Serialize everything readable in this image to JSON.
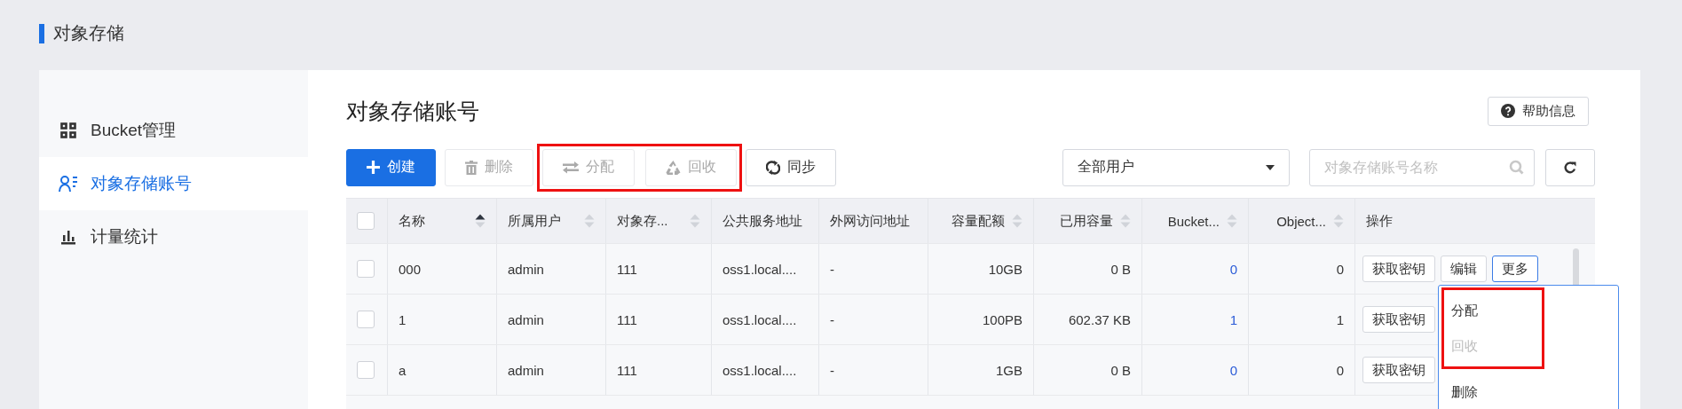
{
  "page_title": "对象存储",
  "sidebar": {
    "items": [
      {
        "label": "Bucket管理",
        "kind": "grid",
        "selected": false
      },
      {
        "label": "对象存储账号",
        "kind": "users",
        "selected": true
      },
      {
        "label": "计量统计",
        "kind": "chart",
        "selected": false
      }
    ]
  },
  "content": {
    "title": "对象存储账号",
    "help_button": "帮助信息",
    "toolbar": [
      {
        "highlighted": false,
        "buttons": [
          {
            "label": "创建",
            "kind": "create",
            "disabled": false
          },
          {
            "label": "删除",
            "kind": "delete",
            "disabled": true
          }
        ]
      },
      {
        "highlighted": true,
        "buttons": [
          {
            "label": "分配",
            "kind": "assign",
            "disabled": true
          },
          {
            "label": "回收",
            "kind": "reclaim",
            "disabled": true
          }
        ]
      },
      {
        "highlighted": false,
        "buttons": [
          {
            "label": "同步",
            "kind": "sync",
            "disabled": false
          }
        ]
      }
    ],
    "user_filter": {
      "value": "全部用户"
    },
    "search": {
      "placeholder": "对象存储账号名称"
    },
    "table": {
      "select_all_checked": false,
      "columns": [
        {
          "label": "名称",
          "sortable": true,
          "sorted": true,
          "kind": "text"
        },
        {
          "label": "所属用户",
          "sortable": true,
          "sorted": false,
          "kind": "text"
        },
        {
          "label": "对象存...",
          "sortable": true,
          "sorted": false,
          "kind": "text"
        },
        {
          "label": "公共服务地址",
          "sortable": false,
          "kind": "text"
        },
        {
          "label": "外网访问地址",
          "sortable": false,
          "kind": "text"
        },
        {
          "label": "容量配额",
          "sortable": true,
          "sorted": false,
          "kind": "number"
        },
        {
          "label": "已用容量",
          "sortable": true,
          "sorted": false,
          "kind": "number"
        },
        {
          "label": "Bucket...",
          "sortable": true,
          "sorted": false,
          "kind": "link"
        },
        {
          "label": "Object...",
          "sortable": true,
          "sorted": false,
          "kind": "number"
        },
        {
          "label": "操作",
          "sortable": false,
          "kind": "actions"
        }
      ],
      "rows": [
        {
          "checked": false,
          "cells": [
            "000",
            "admin",
            "111",
            "oss1.local....",
            "-",
            "10GB",
            "0 B",
            "0",
            "0"
          ],
          "actions": [
            {
              "label": "获取密钥",
              "active": false
            },
            {
              "label": "编辑",
              "active": false
            },
            {
              "label": "更多",
              "active": true
            }
          ]
        },
        {
          "checked": false,
          "cells": [
            "1",
            "admin",
            "111",
            "oss1.local....",
            "-",
            "100PB",
            "602.37 KB",
            "1",
            "1"
          ],
          "actions": [
            {
              "label": "获取密钥",
              "active": false
            }
          ]
        },
        {
          "checked": false,
          "cells": [
            "a",
            "admin",
            "111",
            "oss1.local....",
            "-",
            "1GB",
            "0 B",
            "0",
            "0"
          ],
          "actions": [
            {
              "label": "获取密钥",
              "active": false
            }
          ]
        }
      ]
    },
    "dropdown_menu": {
      "groups": [
        {
          "highlighted": true,
          "items": [
            {
              "label": "分配",
              "disabled": false
            },
            {
              "label": "回收",
              "disabled": true
            }
          ]
        },
        {
          "highlighted": false,
          "items": [
            {
              "label": "删除",
              "disabled": false
            }
          ]
        }
      ]
    }
  }
}
